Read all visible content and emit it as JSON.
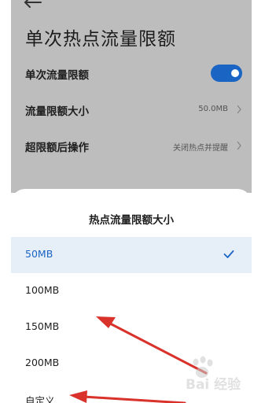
{
  "settings_page": {
    "title": "单次热点流量限额",
    "rows": [
      {
        "label": "单次流量限额",
        "toggle_on": true
      },
      {
        "label": "流量限额大小",
        "value": "50.0MB"
      },
      {
        "label": "超限额后操作",
        "value": "关闭热点并提醒"
      }
    ]
  },
  "sheet": {
    "title": "热点流量限额大小",
    "options": [
      {
        "label": "50MB",
        "selected": true
      },
      {
        "label": "100MB",
        "selected": false
      },
      {
        "label": "150MB",
        "selected": false
      },
      {
        "label": "200MB",
        "selected": false
      },
      {
        "label": "自定义",
        "selected": false
      }
    ]
  },
  "watermark": {
    "text": "Bai 经验"
  },
  "colors": {
    "accent": "#1a64c4",
    "annotation": "#d8322b"
  }
}
